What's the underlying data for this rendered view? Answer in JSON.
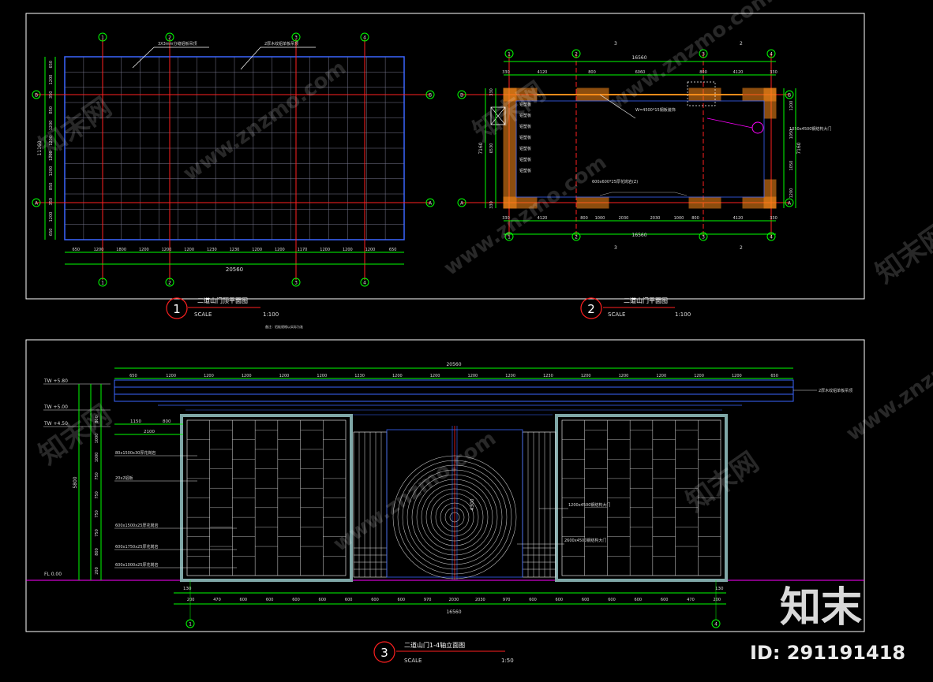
{
  "colors": {
    "background": "#000000",
    "frame": "#ffffff",
    "dimension": "#00ff00",
    "axis": "#ff2020",
    "grid": "#8a8aa0",
    "wall": "#ff8c1a",
    "blue": "#3a66ff",
    "cyan": "#00ffff",
    "yellow": "#ffff00",
    "magenta": "#ff00ff",
    "text": "#e8e8e8",
    "watermark": "#ffffff"
  },
  "plan1": {
    "title": "二道山门顶平面图",
    "number": "1",
    "scale_label": "SCALE",
    "scale_value": "1:100",
    "axis_top": [
      "1",
      "2",
      "3",
      "4"
    ],
    "axis_side": [
      "B",
      "A"
    ],
    "top_dims": [
      "650",
      "1200",
      "1800",
      "1200",
      "1200",
      "1200",
      "1230",
      "1230",
      "1200",
      "1200",
      "1170",
      "1200",
      "1200",
      "1200",
      "650"
    ],
    "bottom_total": "20560",
    "side_total": "11160",
    "side_dims": [
      "650",
      "1200",
      "350",
      "850",
      "1200",
      "1200",
      "1200",
      "1200",
      "850",
      "350",
      "1200",
      "650"
    ],
    "note_a": "3X3mm分缝铝板吊顶",
    "note_b": "2厚木纹铝单板吊顶",
    "footnote": "备注：铝板规格以实际为准"
  },
  "plan2": {
    "title": "二道山门平面图",
    "number": "2",
    "scale_label": "SCALE",
    "scale_value": "1:100",
    "axis_top": [
      "1",
      "2",
      "3",
      "4"
    ],
    "section_top": [
      "3",
      "2"
    ],
    "total": "16560",
    "top_dims": [
      "330",
      "4120",
      "800",
      "6060",
      "800",
      "4120",
      "330"
    ],
    "bottom_dims": [
      "330",
      "4120",
      "800",
      "1000",
      "2030",
      "2030",
      "1000",
      "800",
      "4120",
      "330"
    ],
    "left_dims": [
      "330",
      "6530",
      "330"
    ],
    "left_total": "7160",
    "right_dims": [
      "1200",
      "1050",
      "1050",
      "1200"
    ],
    "labels": [
      "铝塑板",
      "铝塑板",
      "铝塑板",
      "铝塑板",
      "铝塑板",
      "铝塑板",
      "铝塑板"
    ],
    "note_door": "W=4500*15钢板装饰",
    "note_right": "1050x4500钢结构大门",
    "note_floor": "600x600*25厚花岗岩(Z)"
  },
  "elev": {
    "title": "二道山门1-4轴立面图",
    "number": "3",
    "scale_label": "SCALE",
    "scale_value": "1:50",
    "levels": [
      "TW +5.80",
      "TW +5.00",
      "TW +4.50",
      "FL 0.00"
    ],
    "top_total": "20560",
    "top_dims": [
      "650",
      "1200",
      "1200",
      "1200",
      "1200",
      "1200",
      "1230",
      "1200",
      "1200",
      "1200",
      "1200",
      "1230",
      "1200",
      "1200",
      "1200",
      "1200",
      "1200",
      "650"
    ],
    "bottom_total": "16560",
    "bottom_dims": [
      "200",
      "470",
      "600",
      "600",
      "600",
      "600",
      "600",
      "600",
      "600",
      "970",
      "2030",
      "2030",
      "970",
      "600",
      "600",
      "600",
      "600",
      "600",
      "600",
      "470",
      "200"
    ],
    "dim_1150": "1150",
    "dim_800": "800",
    "dim_2100": "2100",
    "left_side_dims": [
      "800",
      "1000",
      "1000",
      "750",
      "750",
      "750",
      "750",
      "800",
      "200"
    ],
    "left_total": "5800",
    "door_height": "4300",
    "notes_left": [
      "80x1500x30厚花岗岩",
      "20x2铝板",
      "600x1500x25厚花岗岩",
      "600x1750x25厚花岗岩",
      "600x1000x25厚花岗岩"
    ],
    "note_right": "2厚木纹铝单板吊顶",
    "note_door1": "1200x4500钢结构大门",
    "note_door2": "2600x4500钢结构大门",
    "axis_marks": [
      "1",
      "4"
    ],
    "mark_130a": "130",
    "mark_130b": "130"
  },
  "watermark": {
    "brand": "知末",
    "id_text": "ID: 291191418",
    "tile_text": "www.znzmo.com",
    "tile_brand": "知末网"
  }
}
